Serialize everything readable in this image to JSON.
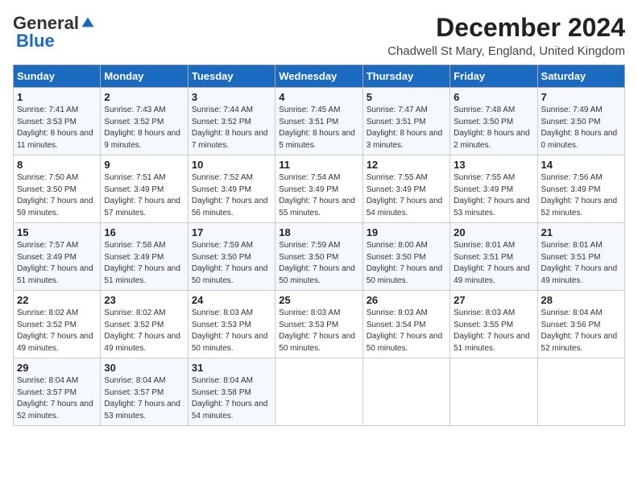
{
  "logo": {
    "general": "General",
    "blue": "Blue"
  },
  "title": "December 2024",
  "location": "Chadwell St Mary, England, United Kingdom",
  "days_header": [
    "Sunday",
    "Monday",
    "Tuesday",
    "Wednesday",
    "Thursday",
    "Friday",
    "Saturday"
  ],
  "weeks": [
    [
      {
        "day": "1",
        "sunrise": "7:41 AM",
        "sunset": "3:53 PM",
        "daylight": "8 hours and 11 minutes."
      },
      {
        "day": "2",
        "sunrise": "7:43 AM",
        "sunset": "3:52 PM",
        "daylight": "8 hours and 9 minutes."
      },
      {
        "day": "3",
        "sunrise": "7:44 AM",
        "sunset": "3:52 PM",
        "daylight": "8 hours and 7 minutes."
      },
      {
        "day": "4",
        "sunrise": "7:45 AM",
        "sunset": "3:51 PM",
        "daylight": "8 hours and 5 minutes."
      },
      {
        "day": "5",
        "sunrise": "7:47 AM",
        "sunset": "3:51 PM",
        "daylight": "8 hours and 3 minutes."
      },
      {
        "day": "6",
        "sunrise": "7:48 AM",
        "sunset": "3:50 PM",
        "daylight": "8 hours and 2 minutes."
      },
      {
        "day": "7",
        "sunrise": "7:49 AM",
        "sunset": "3:50 PM",
        "daylight": "8 hours and 0 minutes."
      }
    ],
    [
      {
        "day": "8",
        "sunrise": "7:50 AM",
        "sunset": "3:50 PM",
        "daylight": "7 hours and 59 minutes."
      },
      {
        "day": "9",
        "sunrise": "7:51 AM",
        "sunset": "3:49 PM",
        "daylight": "7 hours and 57 minutes."
      },
      {
        "day": "10",
        "sunrise": "7:52 AM",
        "sunset": "3:49 PM",
        "daylight": "7 hours and 56 minutes."
      },
      {
        "day": "11",
        "sunrise": "7:54 AM",
        "sunset": "3:49 PM",
        "daylight": "7 hours and 55 minutes."
      },
      {
        "day": "12",
        "sunrise": "7:55 AM",
        "sunset": "3:49 PM",
        "daylight": "7 hours and 54 minutes."
      },
      {
        "day": "13",
        "sunrise": "7:55 AM",
        "sunset": "3:49 PM",
        "daylight": "7 hours and 53 minutes."
      },
      {
        "day": "14",
        "sunrise": "7:56 AM",
        "sunset": "3:49 PM",
        "daylight": "7 hours and 52 minutes."
      }
    ],
    [
      {
        "day": "15",
        "sunrise": "7:57 AM",
        "sunset": "3:49 PM",
        "daylight": "7 hours and 51 minutes."
      },
      {
        "day": "16",
        "sunrise": "7:58 AM",
        "sunset": "3:49 PM",
        "daylight": "7 hours and 51 minutes."
      },
      {
        "day": "17",
        "sunrise": "7:59 AM",
        "sunset": "3:50 PM",
        "daylight": "7 hours and 50 minutes."
      },
      {
        "day": "18",
        "sunrise": "7:59 AM",
        "sunset": "3:50 PM",
        "daylight": "7 hours and 50 minutes."
      },
      {
        "day": "19",
        "sunrise": "8:00 AM",
        "sunset": "3:50 PM",
        "daylight": "7 hours and 50 minutes."
      },
      {
        "day": "20",
        "sunrise": "8:01 AM",
        "sunset": "3:51 PM",
        "daylight": "7 hours and 49 minutes."
      },
      {
        "day": "21",
        "sunrise": "8:01 AM",
        "sunset": "3:51 PM",
        "daylight": "7 hours and 49 minutes."
      }
    ],
    [
      {
        "day": "22",
        "sunrise": "8:02 AM",
        "sunset": "3:52 PM",
        "daylight": "7 hours and 49 minutes."
      },
      {
        "day": "23",
        "sunrise": "8:02 AM",
        "sunset": "3:52 PM",
        "daylight": "7 hours and 49 minutes."
      },
      {
        "day": "24",
        "sunrise": "8:03 AM",
        "sunset": "3:53 PM",
        "daylight": "7 hours and 50 minutes."
      },
      {
        "day": "25",
        "sunrise": "8:03 AM",
        "sunset": "3:53 PM",
        "daylight": "7 hours and 50 minutes."
      },
      {
        "day": "26",
        "sunrise": "8:03 AM",
        "sunset": "3:54 PM",
        "daylight": "7 hours and 50 minutes."
      },
      {
        "day": "27",
        "sunrise": "8:03 AM",
        "sunset": "3:55 PM",
        "daylight": "7 hours and 51 minutes."
      },
      {
        "day": "28",
        "sunrise": "8:04 AM",
        "sunset": "3:56 PM",
        "daylight": "7 hours and 52 minutes."
      }
    ],
    [
      {
        "day": "29",
        "sunrise": "8:04 AM",
        "sunset": "3:57 PM",
        "daylight": "7 hours and 52 minutes."
      },
      {
        "day": "30",
        "sunrise": "8:04 AM",
        "sunset": "3:57 PM",
        "daylight": "7 hours and 53 minutes."
      },
      {
        "day": "31",
        "sunrise": "8:04 AM",
        "sunset": "3:58 PM",
        "daylight": "7 hours and 54 minutes."
      },
      null,
      null,
      null,
      null
    ]
  ]
}
